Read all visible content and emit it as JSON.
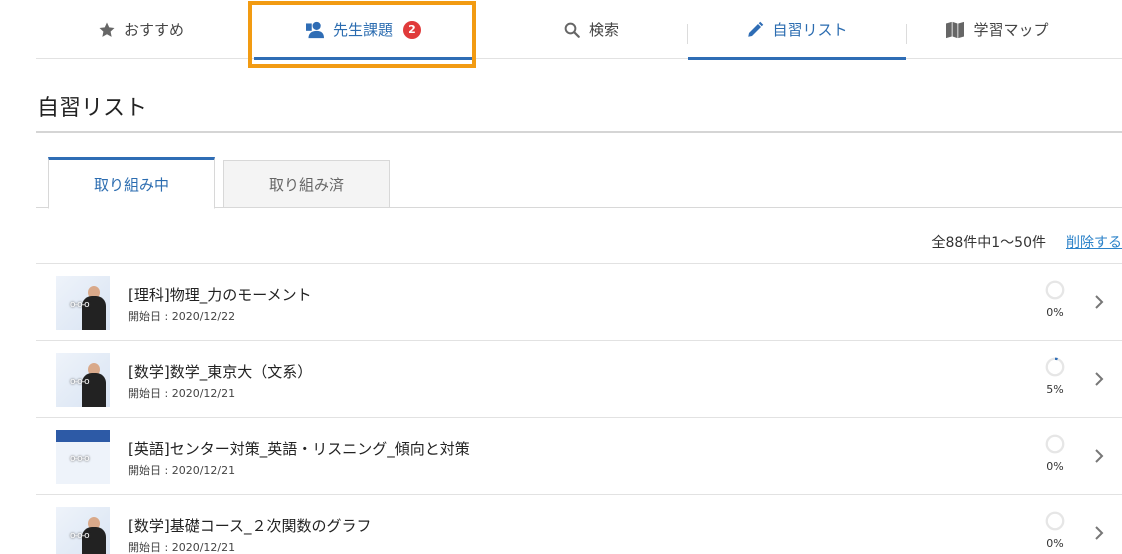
{
  "nav": {
    "items": [
      {
        "id": "recommend",
        "label": "おすすめ",
        "icon": "star-icon"
      },
      {
        "id": "teacher",
        "label": "先生課題",
        "icon": "teacher-icon",
        "badge": "2"
      },
      {
        "id": "search",
        "label": "検索",
        "icon": "search-icon"
      },
      {
        "id": "selfstudy",
        "label": "自習リスト",
        "icon": "pencil-icon"
      },
      {
        "id": "map",
        "label": "学習マップ",
        "icon": "map-icon"
      }
    ]
  },
  "page": {
    "title": "自習リスト"
  },
  "tabs": {
    "active": "取り組み中",
    "inactive": "取り組み済"
  },
  "list_header": {
    "count": "全88件中1〜50件",
    "delete_label": "削除する"
  },
  "items": [
    {
      "title": "[理科]物理_力のモーメント",
      "date": "開始日 : 2020/12/22",
      "percent": "0%",
      "progress": 0
    },
    {
      "title": "[数学]数学_東京大（文系）",
      "date": "開始日 : 2020/12/21",
      "percent": "5%",
      "progress": 0.05
    },
    {
      "title": "[英語]センター対策_英語・リスニング_傾向と対策",
      "date": "開始日 : 2020/12/21",
      "percent": "0%",
      "progress": 0
    },
    {
      "title": "[数学]基礎コース_２次関数のグラフ",
      "date": "開始日 : 2020/12/21",
      "percent": "0%",
      "progress": 0
    }
  ],
  "colors": {
    "accent": "#2f6db5",
    "highlight": "#f29b12",
    "badge": "#e03a3a",
    "link": "#2b82c9"
  }
}
